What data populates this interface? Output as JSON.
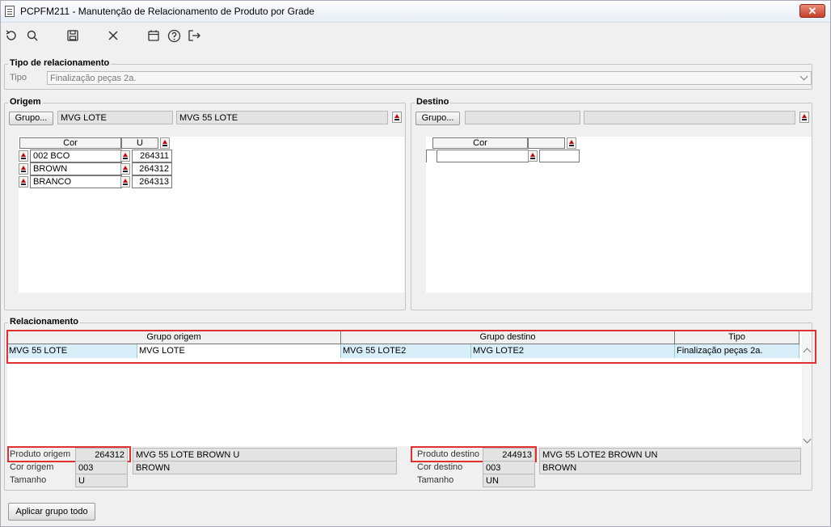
{
  "window": {
    "title": "PCPFM211 - Manutenção de Relacionamento de Produto por Grade",
    "close_symbol": "✕"
  },
  "toolbar": {
    "icons": [
      "refresh-icon",
      "search-icon",
      "save-icon",
      "cancel-icon",
      "calendar-icon",
      "help-icon",
      "exit-icon"
    ]
  },
  "tipo_relacionamento": {
    "legend": "Tipo de relacionamento",
    "tipo_label": "Tipo",
    "tipo_value": "Finalização peças 2a."
  },
  "origem": {
    "legend": "Origem",
    "grupo_button": "Grupo...",
    "grupo_code": "MVG LOTE",
    "grupo_desc": "MVG 55 LOTE",
    "grid": {
      "col_cor": "Cor",
      "col_u": "U",
      "rows": [
        {
          "cor": "002 BCO",
          "u": "264311"
        },
        {
          "cor": "BROWN",
          "u": "264312"
        },
        {
          "cor": "BRANCO",
          "u": "264313"
        }
      ]
    }
  },
  "destino": {
    "legend": "Destino",
    "grupo_button": "Grupo...",
    "grupo_code": "",
    "grupo_desc": "",
    "grid": {
      "col_cor": "Cor",
      "rows": [
        {
          "cor": "",
          "value": ""
        }
      ]
    }
  },
  "relacionamento": {
    "legend": "Relacionamento",
    "headers": {
      "grupo_origem": "Grupo origem",
      "grupo_destino": "Grupo destino",
      "tipo": "Tipo"
    },
    "rows": [
      {
        "origem_desc": "MVG 55 LOTE",
        "origem_code": "MVG LOTE",
        "destino_desc": "MVG 55 LOTE2",
        "destino_code": "MVG LOTE2",
        "tipo": "Finalização peças 2a."
      }
    ],
    "produto_origem": {
      "label": "Produto origem",
      "value": "264312",
      "desc": "MVG 55 LOTE BROWN U",
      "cor_label": "Cor origem",
      "cor_code": "003",
      "cor_desc": "BROWN",
      "tamanho_label": "Tamanho",
      "tamanho_value": "U"
    },
    "produto_destino": {
      "label": "Produto destino",
      "value": "244913",
      "desc": "MVG 55 LOTE2 BROWN UN",
      "cor_label": "Cor destino",
      "cor_code": "003",
      "cor_desc": "BROWN",
      "tamanho_label": "Tamanho",
      "tamanho_value": "UN"
    }
  },
  "footer": {
    "apply_button": "Aplicar grupo todo"
  },
  "colors": {
    "highlight_red": "#e03030",
    "selected_row": "#d8effa",
    "close_button": "#c6402a"
  }
}
